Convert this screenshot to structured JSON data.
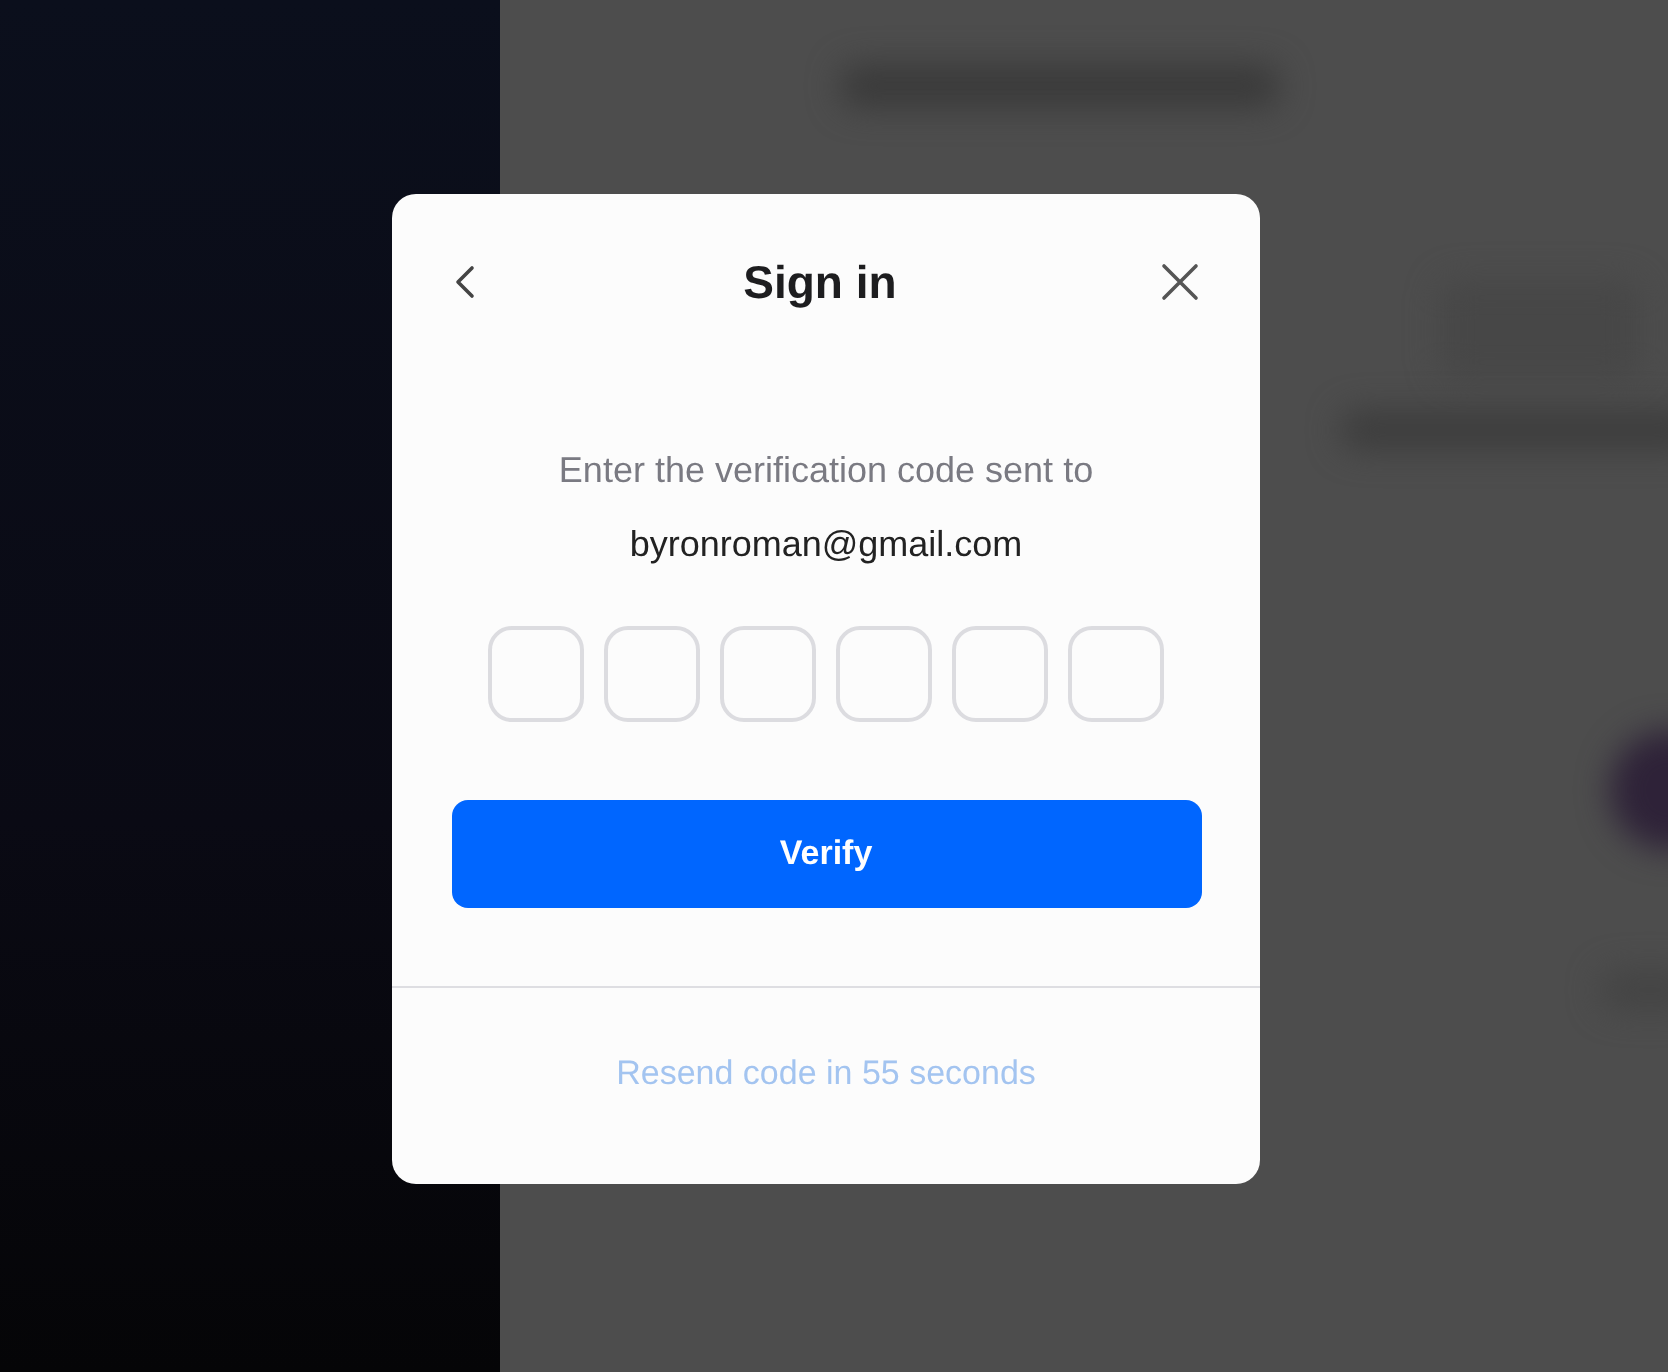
{
  "dialog": {
    "title": "Sign in",
    "message": "Enter the verification code sent to",
    "email": "byronroman@gmail.com",
    "code_boxes": [
      {
        "focused": false
      },
      {
        "focused": false
      },
      {
        "focused": false
      },
      {
        "focused": false
      },
      {
        "focused": false
      },
      {
        "focused": false
      }
    ],
    "primary_button": "Verify",
    "resend": {
      "label": "Resend code in 55 seconds",
      "disabled": true
    }
  }
}
